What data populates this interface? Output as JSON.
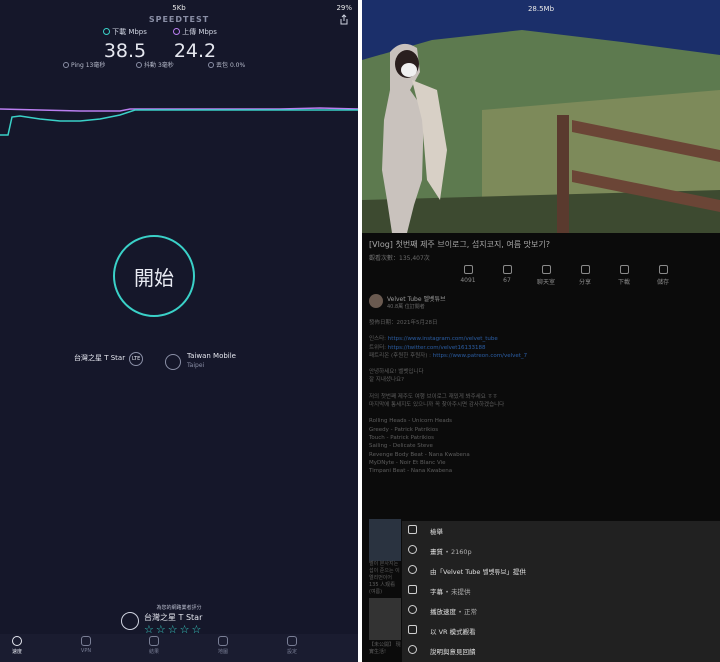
{
  "speedtest": {
    "status_center": "5Kb",
    "battery": "29%",
    "brand": "SPEEDTEST",
    "download_label": "下載 Mbps",
    "download_value": "38.5",
    "upload_label": "上傳 Mbps",
    "upload_value": "24.2",
    "ping_label": "Ping",
    "ping_value": "13毫秒",
    "jitter_label": "抖動",
    "jitter_value": "3毫秒",
    "loss_label": "丟包",
    "loss_value": "0.0%",
    "go_label": "開始",
    "provider": "台灣之星 T Star",
    "provider_badge": "LTE",
    "server_name": "Taiwan Mobile",
    "server_city": "Taipei",
    "rate_prompt": "為您的網路業者評分",
    "rate_provider": "台灣之星 T Star",
    "stars": "☆☆☆☆☆",
    "tabs": [
      {
        "label": "速度"
      },
      {
        "label": "VPN"
      },
      {
        "label": "結果"
      },
      {
        "label": "地圖"
      },
      {
        "label": "設定"
      }
    ],
    "colors": {
      "accent": "#3ad1c8",
      "download": "#3ad1c8",
      "upload": "#b97ef0"
    }
  },
  "video": {
    "status_center": "28.5Mb",
    "title": "[Vlog] 첫번째 제주 브이로그, 섭지코지, 여름 맛보기?",
    "views": "觀看次數：135,407次",
    "actions": [
      {
        "label": "4091",
        "icon": "thumbs-up-icon"
      },
      {
        "label": "67",
        "icon": "thumbs-down-icon"
      },
      {
        "label": "聊天室",
        "icon": "chat-icon"
      },
      {
        "label": "分享",
        "icon": "share-icon"
      },
      {
        "label": "下載",
        "icon": "download-icon"
      },
      {
        "label": "儲存",
        "icon": "save-icon"
      }
    ],
    "channel_name": "Velvet Tube 벨벳튜브",
    "channel_subs": "40.8萬 位訂閱者",
    "description": {
      "date": "發佈日期：2021年5月28日",
      "instagram_label": "인스타: ",
      "instagram_url": "https://www.instagram.com/velvet_tube",
      "twitter_label": "트위터: ",
      "twitter_url": "https://twitter.com/velvet16133188",
      "patreon_label": "패트리온 (후원한 후원자) : ",
      "patreon_url": "https://www.patreon.com/velvet_7",
      "greeting_1": "안녕하세요! 벨벳입니다",
      "greeting_2": "잘 지내셨나요?",
      "body_1": "저의 첫번째 제주도 여행 브이로그 재밌게 봐주세요 ㅎㅎ",
      "body_2": "마지막에 통세지도 있으니까 꼭 찾아주시면 감사하겠습니다",
      "music": [
        "Rolling Heads - Unicorn Heads",
        "Greedy - Patrick Patrikios",
        "Touch - Patrick Patrikios",
        "Sailing - Delicate Steve",
        "Revenge Body Beat - Nana Kwabena",
        "MyDNyte - Noir Et Blanc Vie",
        "Timpani Beat - Nana Kwabena"
      ]
    },
    "side_text": "벨이 본사지는 섭이 준으는 이 엘리먼이어 135 人观看 (여름)",
    "side_text_2": "【未公開】\n現實生活!",
    "menu": [
      {
        "label": "檢舉",
        "value": "",
        "icon": "flag-icon"
      },
      {
        "label": "畫質",
        "value": "2160p",
        "icon": "gear-icon"
      },
      {
        "label": "由「Velvet Tube 벨벳튜브」提供",
        "value": "",
        "icon": "info-icon"
      },
      {
        "label": "字幕",
        "value": "未提供",
        "icon": "captions-icon"
      },
      {
        "label": "播放速度",
        "value": "正常",
        "icon": "playback-speed-icon"
      },
      {
        "label": "以 VR 模式觀看",
        "value": "",
        "icon": "vr-icon"
      },
      {
        "label": "說明與意見回饋",
        "value": "",
        "icon": "help-icon"
      }
    ],
    "menu_sep": "•"
  }
}
